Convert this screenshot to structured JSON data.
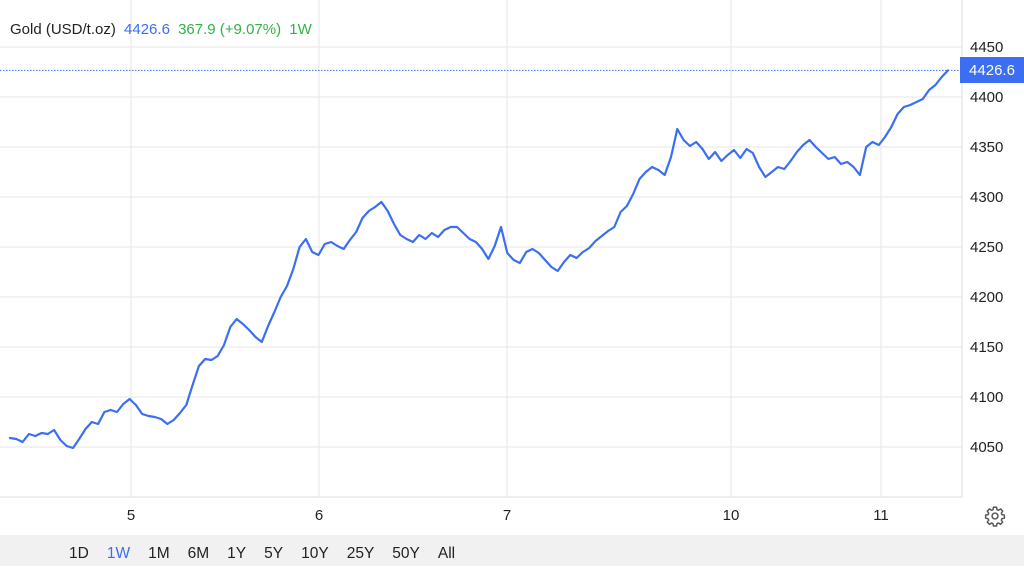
{
  "header": {
    "title": "Gold (USD/t.oz)",
    "price": "4426.6",
    "change": "367.9 (+9.07%)",
    "period": "1W"
  },
  "price_tag": "4426.6",
  "range_buttons": [
    {
      "label": "1D",
      "active": false
    },
    {
      "label": "1W",
      "active": true
    },
    {
      "label": "1M",
      "active": false
    },
    {
      "label": "6M",
      "active": false
    },
    {
      "label": "1Y",
      "active": false
    },
    {
      "label": "5Y",
      "active": false
    },
    {
      "label": "10Y",
      "active": false
    },
    {
      "label": "25Y",
      "active": false
    },
    {
      "label": "50Y",
      "active": false
    },
    {
      "label": "All",
      "active": false
    }
  ],
  "settings_icon": "gear-icon",
  "colors": {
    "line": "#3b6ef0",
    "change_positive": "#2fb344",
    "grid": "#e6e6e6",
    "toolbar_bg": "#f1f1f1"
  },
  "chart_data": {
    "type": "line",
    "title": "Gold (USD/t.oz)",
    "xlabel": "",
    "ylabel": "",
    "x_ticks": [
      "5",
      "6",
      "7",
      "10",
      "11"
    ],
    "y_ticks": [
      4050,
      4100,
      4150,
      4200,
      4250,
      4300,
      4350,
      4400,
      4450
    ],
    "ylim": [
      4000,
      4450
    ],
    "last_value": 4426.6,
    "grid": true,
    "series": [
      {
        "values": [
          4059,
          4058,
          4055,
          4063,
          4061,
          4064,
          4063,
          4067,
          4057,
          4051,
          4049,
          4058,
          4068,
          4075,
          4073,
          4085,
          4087,
          4085,
          4093,
          4098,
          4092,
          4083,
          4081,
          4080,
          4078,
          4073,
          4077,
          4084,
          4092,
          4112,
          4131,
          4138,
          4137,
          4141,
          4152,
          4170,
          4178,
          4173,
          4167,
          4160,
          4155,
          4171,
          4185,
          4200,
          4211,
          4228,
          4250,
          4258,
          4245,
          4242,
          4253,
          4255,
          4251,
          4248,
          4257,
          4265,
          4279,
          4286,
          4290,
          4295,
          4286,
          4273,
          4262,
          4258,
          4255,
          4262,
          4258,
          4264,
          4260,
          4267,
          4270,
          4270,
          4264,
          4258,
          4255,
          4248,
          4238,
          4251,
          4270,
          4244,
          4237,
          4234,
          4245,
          4248,
          4244,
          4237,
          4230,
          4226,
          4235,
          4242,
          4239,
          4245,
          4249,
          4256,
          4261,
          4266,
          4270,
          4285,
          4291,
          4303,
          4318,
          4325,
          4330,
          4327,
          4322,
          4340,
          4368,
          4357,
          4351,
          4355,
          4348,
          4338,
          4345,
          4336,
          4342,
          4347,
          4339,
          4348,
          4344,
          4330,
          4320,
          4325,
          4330,
          4328,
          4336,
          4345,
          4352,
          4357,
          4350,
          4344,
          4338,
          4340,
          4333,
          4335,
          4330,
          4322,
          4350,
          4355,
          4352,
          4360,
          4370,
          4383,
          4390,
          4392,
          4395,
          4398,
          4407,
          4412,
          4420,
          4426.6
        ]
      }
    ]
  }
}
